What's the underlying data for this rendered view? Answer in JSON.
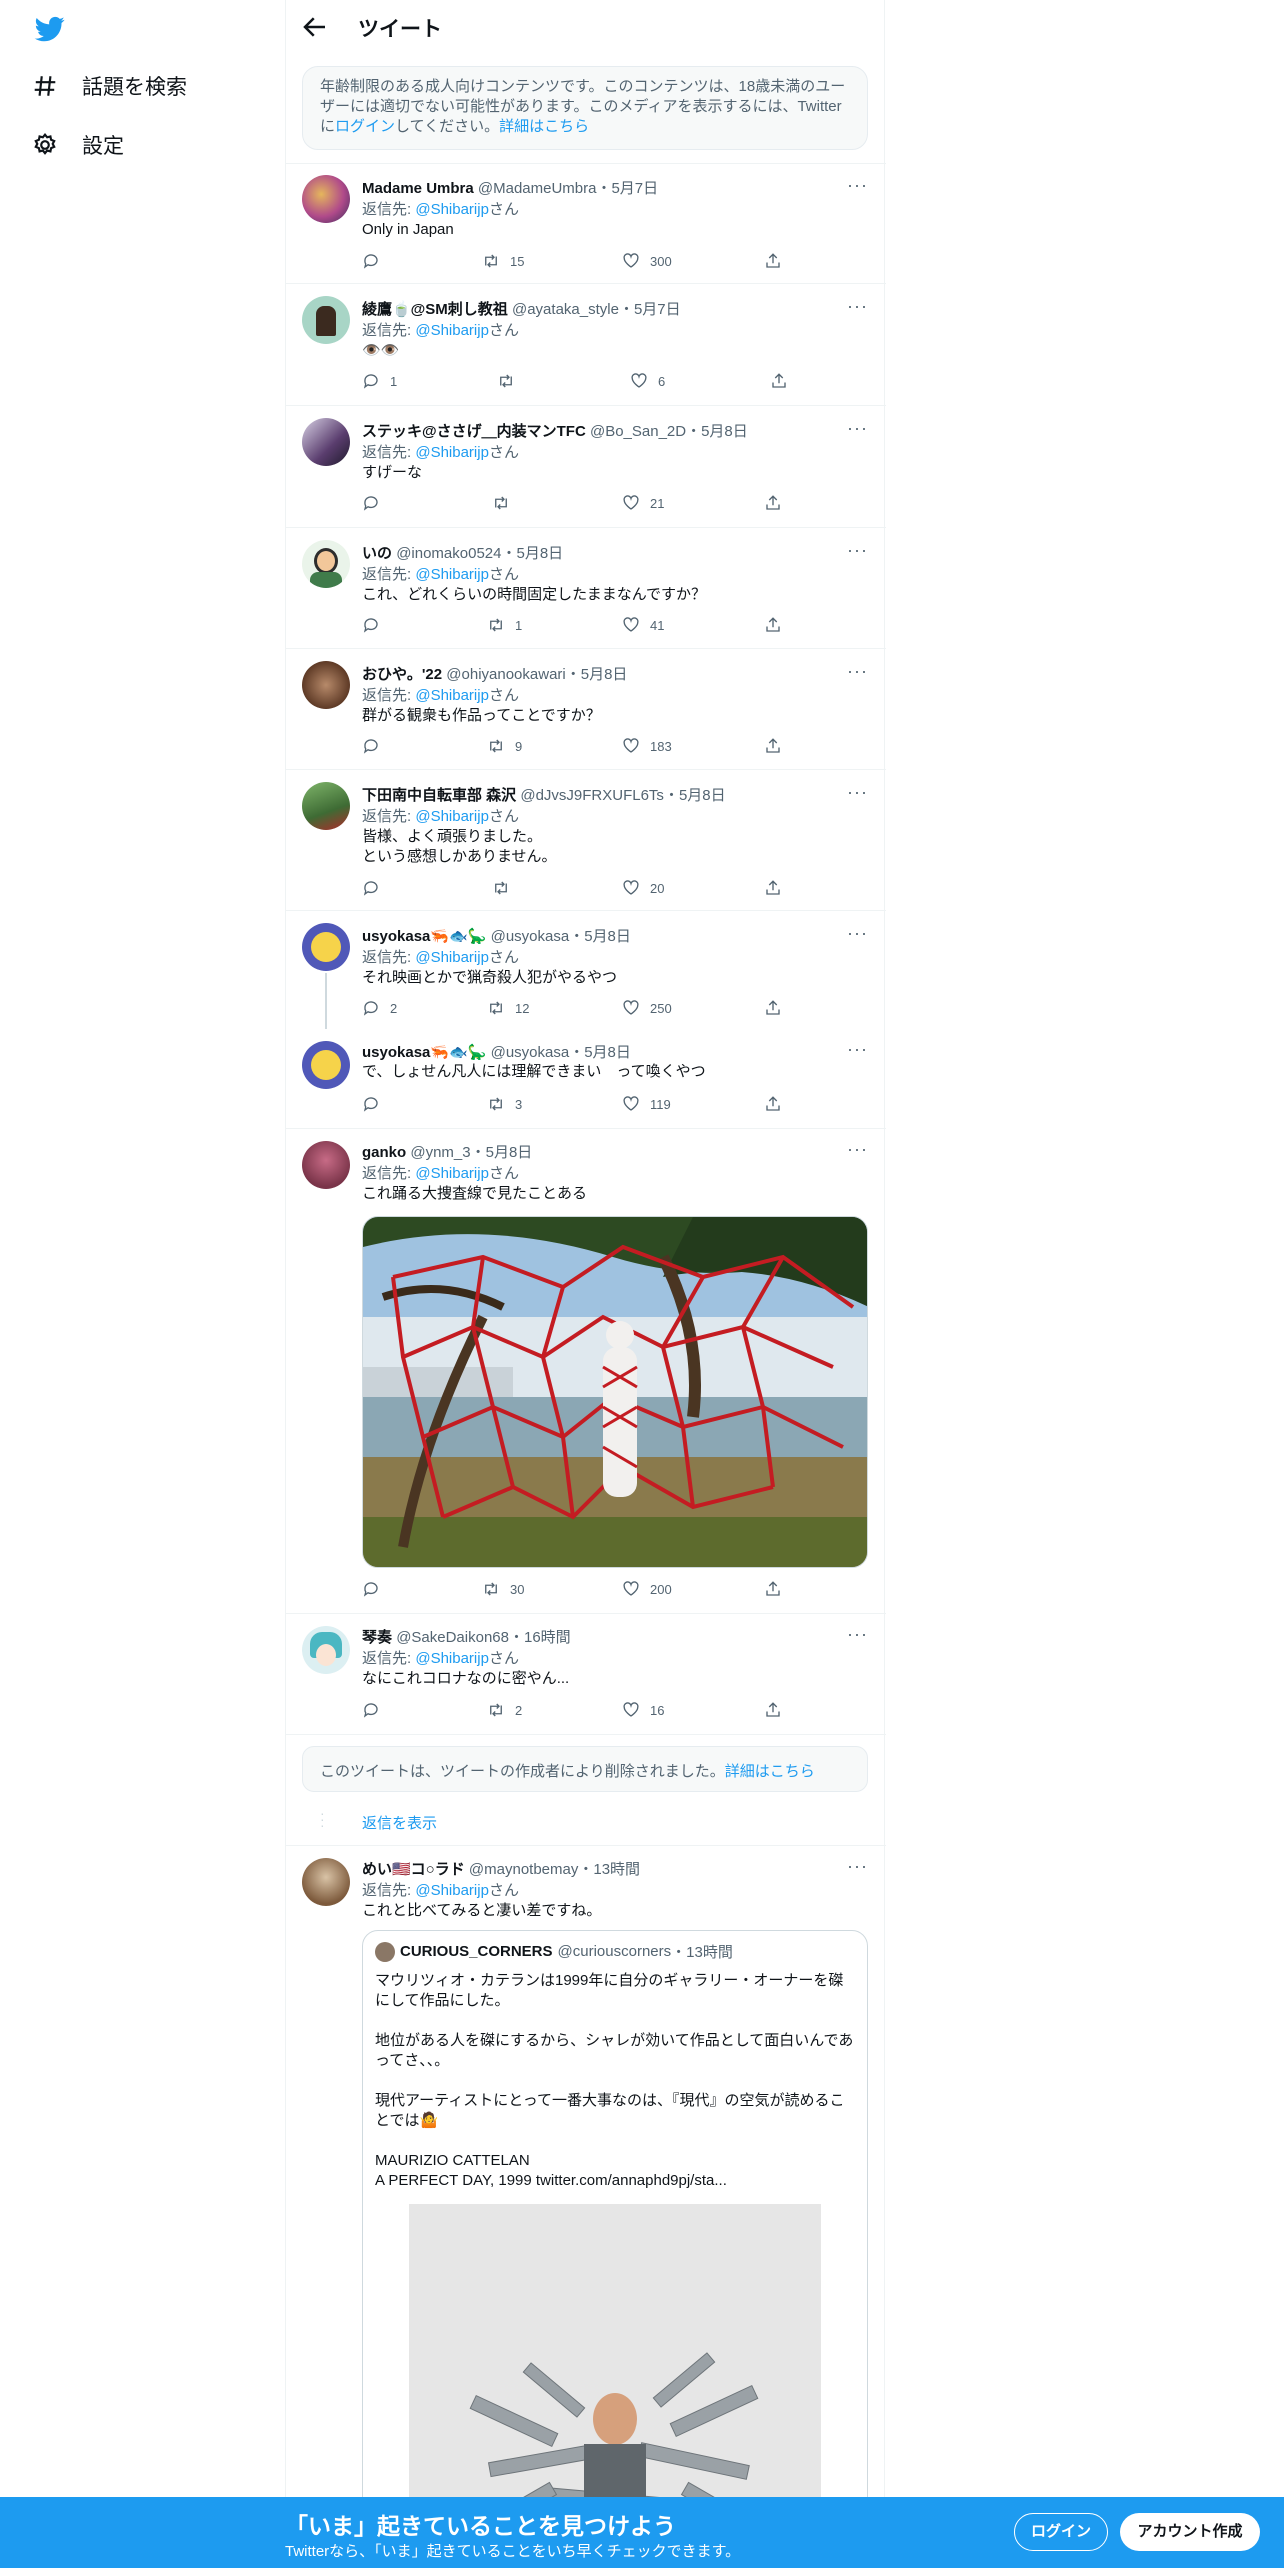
{
  "nav": {
    "explore_label": "話題を検索",
    "settings_label": "設定"
  },
  "header": {
    "title": "ツイート"
  },
  "notice": {
    "text": "年齢制限のある成人向けコンテンツです。このコンテンツは、18歳未満のユーザーには適切でない可能性があります。このメディアを表示するには、Twitterに",
    "login_link": "ログイン",
    "text2": "してください。",
    "details_link": "詳細はこちら"
  },
  "reply_to_prefix": "返信先: ",
  "reply_to_mention": "@Shibarijp",
  "reply_to_suffix": "さん",
  "more_glyph": "···",
  "tweets": [
    {
      "name": "Madame Umbra",
      "handle": "@MadameUmbra",
      "date": "・5月7日",
      "text": "Only in Japan",
      "replies": "",
      "retweets": "15",
      "likes": "300"
    },
    {
      "name": "綾鷹🍵@SM刺し教祖",
      "handle": "@ayataka_style",
      "date": "・5月7日",
      "text": "👁️👁️",
      "replies": "1",
      "retweets": "",
      "likes": "6"
    },
    {
      "name": "ステッキ@ささげ＿内装マンTFC",
      "handle": "@Bo_San_2D",
      "date": "・5月8日",
      "text": "すげーな",
      "replies": "",
      "retweets": "",
      "likes": "21"
    },
    {
      "name": "いの",
      "handle": "@inomako0524",
      "date": "・5月8日",
      "text": "これ、どれくらいの時間固定したままなんですか？",
      "replies": "",
      "retweets": "1",
      "likes": "41"
    },
    {
      "name": "おひや。'22",
      "handle": "@ohiyanookawari",
      "date": "・5月8日",
      "text": "群がる観衆も作品ってことですか？",
      "replies": "",
      "retweets": "9",
      "likes": "183"
    },
    {
      "name": "下田南中自転車部 森沢",
      "handle": "@dJvsJ9FRXUFL6Ts",
      "date": "・5月8日",
      "text": "皆様、よく頑張りました。\nという感想しかありません。",
      "replies": "",
      "retweets": "",
      "likes": "20"
    },
    {
      "name": "usyokasa🦐🐟🦕",
      "handle": "@usyokasa",
      "date": "・5月8日",
      "text": "それ映画とかで猟奇殺人犯がやるやつ",
      "replies": "2",
      "retweets": "12",
      "likes": "250"
    },
    {
      "name": "usyokasa🦐🐟🦕",
      "handle": "@usyokasa",
      "date": "・5月8日",
      "text": "で、しょせん凡人には理解できまい　って喚くやつ",
      "replies": "",
      "retweets": "3",
      "likes": "119"
    },
    {
      "name": "ganko",
      "handle": "@ynm_3",
      "date": "・5月8日",
      "text": "これ踊る大捜査線で見たことある",
      "replies": "",
      "retweets": "30",
      "likes": "200"
    },
    {
      "name": "琴奏",
      "handle": "@SakeDaikon68",
      "date": "・16時間",
      "text": "なにこれコロナなのに密やん...",
      "replies": "",
      "retweets": "2",
      "likes": "16"
    },
    {
      "name": "めい🇺🇸コ○ラド",
      "handle": "@maynotbemay",
      "date": "・13時間",
      "text": "これと比べてみると凄い差ですね。",
      "replies": "",
      "retweets": "",
      "likes": ""
    }
  ],
  "deleted": {
    "text": "このツイートは、ツイートの作成者により削除されました。",
    "link": "詳細はこちら"
  },
  "show_replies": "返信を表示",
  "quote": {
    "name": "CURIOUS_CORNERS",
    "handle": "@curiouscorners",
    "date": "・13時間",
    "text": "マウリツィオ・カテランは1999年に自分のギャラリー・オーナーを磔にして作品にした。\n\n地位がある人を磔にするから、シャレが効いて作品として面白いんであってさ、、。\n\n現代アーティストにとって一番大事なのは、『現代』の空気が読めることでは🤷\n\nMAURIZIO CATTELAN\nA PERFECT DAY, 1999  twitter.com/annaphd9pj/sta..."
  },
  "bottom": {
    "title": "「いま」起きていることを見つけよう",
    "subtitle": "Twitterなら、「いま」起きていることをいち早くチェックできます。",
    "login": "ログイン",
    "signup": "アカウント作成"
  },
  "colors": {
    "accent": "#1d9bf0",
    "secondary_text": "#536471"
  }
}
